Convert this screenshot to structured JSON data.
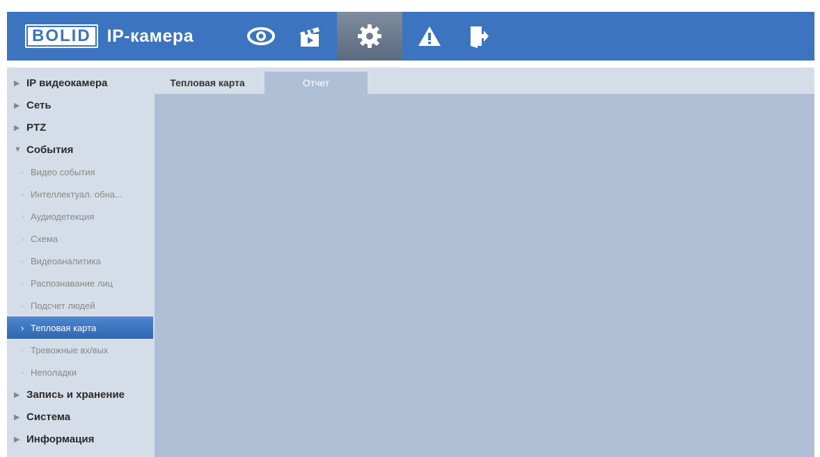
{
  "header": {
    "brand": "BOLID",
    "product": "IP-камера",
    "nav": [
      {
        "icon": "eye-icon",
        "name": "live-view"
      },
      {
        "icon": "clapperboard-icon",
        "name": "playback"
      },
      {
        "icon": "gear-icon",
        "name": "settings",
        "active": true
      },
      {
        "icon": "warning-icon",
        "name": "alarm"
      },
      {
        "icon": "logout-icon",
        "name": "logout"
      }
    ],
    "color": "#3c74bf"
  },
  "sidebar": {
    "items": [
      {
        "label": "IP видеокамера"
      },
      {
        "label": "Сеть"
      },
      {
        "label": "PTZ"
      },
      {
        "label": "События",
        "expanded": true
      },
      {
        "label": "Запись и хранение"
      },
      {
        "label": "Система"
      },
      {
        "label": "Информация"
      }
    ],
    "sub_items": [
      {
        "label": "Видео события"
      },
      {
        "label": "Интеллектуал. обна..."
      },
      {
        "label": "Аудиодетекция"
      },
      {
        "label": "Схема"
      },
      {
        "label": "Видеоаналитика"
      },
      {
        "label": "Распознавание лиц"
      },
      {
        "label": "Подсчет людей"
      },
      {
        "label": "Тепловая карта",
        "active": true
      },
      {
        "label": "Тревожные вх/вых"
      },
      {
        "label": "Неполадки"
      }
    ]
  },
  "main": {
    "tabs": [
      {
        "label": "Тепловая карта",
        "active": true
      },
      {
        "label": "Отчет"
      }
    ]
  }
}
